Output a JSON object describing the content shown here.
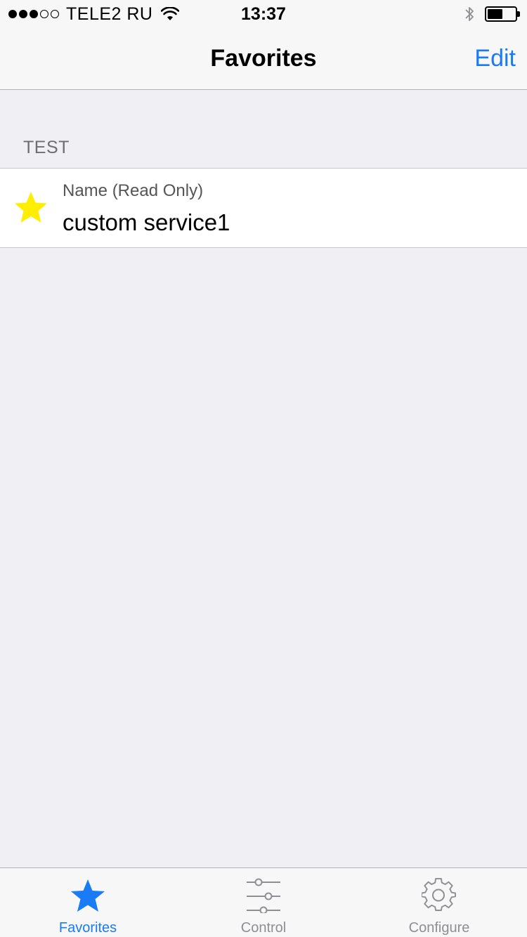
{
  "status_bar": {
    "carrier": "TELE2 RU",
    "time": "13:37",
    "signal_bars_filled": 3,
    "signal_bars_total": 5,
    "battery_level": 0.55
  },
  "nav": {
    "title": "Favorites",
    "edit_label": "Edit"
  },
  "section": {
    "header": "TEST",
    "item": {
      "icon": "star-icon",
      "label": "Name (Read Only)",
      "value": "custom service1"
    }
  },
  "tabs": [
    {
      "label": "Favorites",
      "icon": "star-icon",
      "active": true
    },
    {
      "label": "Control",
      "icon": "sliders-icon",
      "active": false
    },
    {
      "label": "Configure",
      "icon": "gear-icon",
      "active": false
    }
  ],
  "colors": {
    "accent": "#1a7cf5",
    "star": "#ffee00",
    "background": "#efeff4"
  }
}
